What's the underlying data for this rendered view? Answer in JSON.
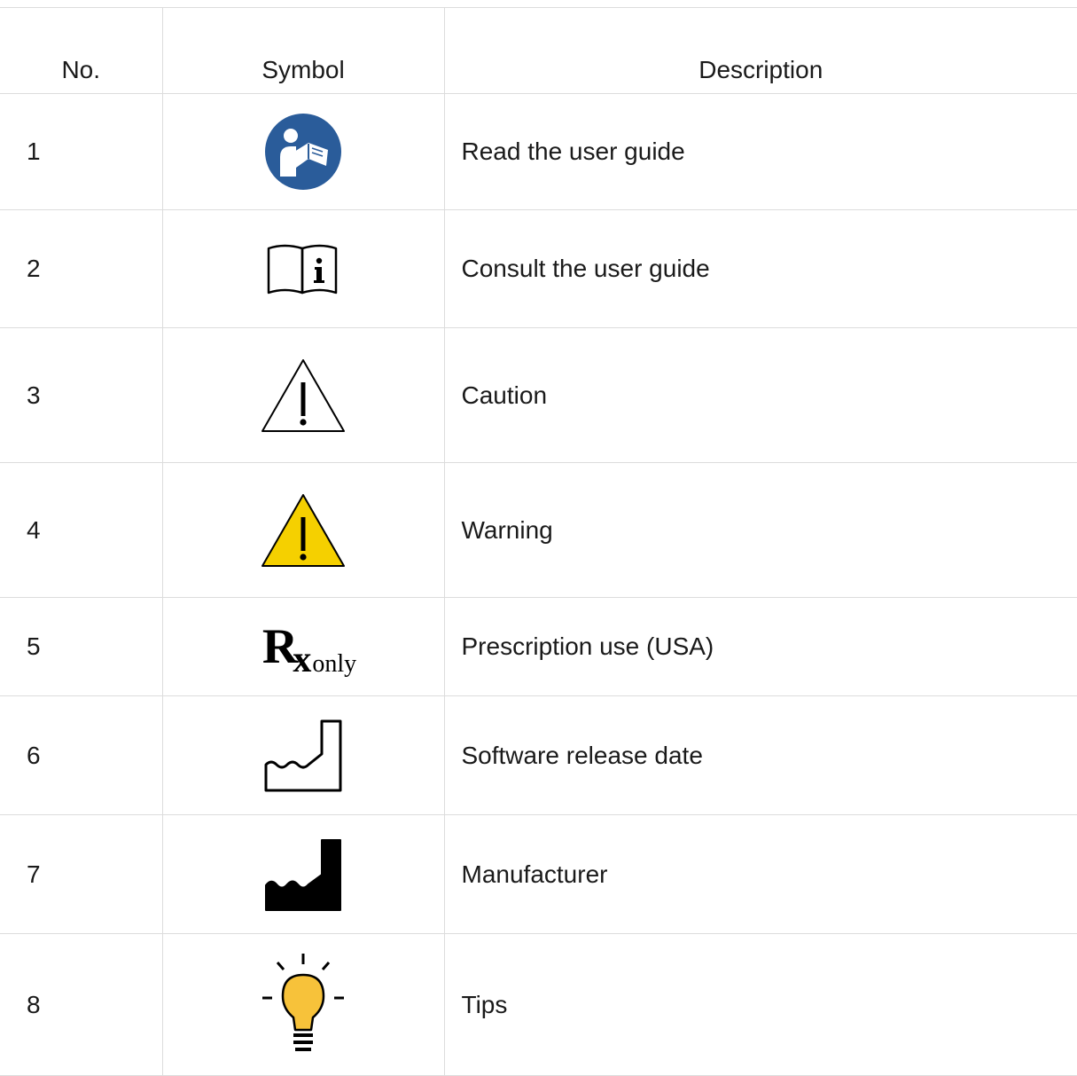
{
  "table": {
    "headers": {
      "no": "No.",
      "symbol": "Symbol",
      "description": "Description"
    },
    "rows": [
      {
        "no": "1",
        "icon": "read-user-guide-icon",
        "description": "Read the user guide"
      },
      {
        "no": "2",
        "icon": "consult-user-guide-icon",
        "description": "Consult the user guide"
      },
      {
        "no": "3",
        "icon": "caution-icon",
        "description": "Caution"
      },
      {
        "no": "4",
        "icon": "warning-icon",
        "description": "Warning"
      },
      {
        "no": "5",
        "icon": "rx-only-icon",
        "description": "Prescription use (USA)",
        "rx_text": {
          "r": "R",
          "x": "x",
          "only": "only"
        }
      },
      {
        "no": "6",
        "icon": "date-of-manufacture-icon",
        "description": "Software release date"
      },
      {
        "no": "7",
        "icon": "manufacturer-icon",
        "description": "Manufacturer"
      },
      {
        "no": "8",
        "icon": "lightbulb-icon",
        "description": "Tips"
      }
    ]
  },
  "colors": {
    "border": "#dcdcdc",
    "text": "#1a1a1a",
    "guide_blue": "#2a5c9a",
    "warning_yellow": "#f5d000",
    "bulb_yellow": "#f7c23a"
  }
}
